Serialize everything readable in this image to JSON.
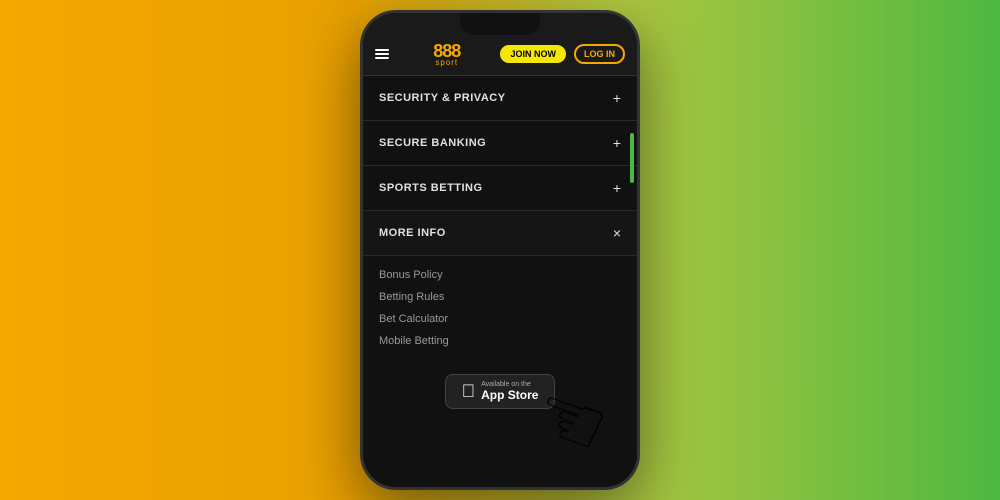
{
  "background": {
    "gradient_from": "#f5a800",
    "gradient_to": "#4db840"
  },
  "header": {
    "logo_888": "888",
    "logo_sport": "sport",
    "join_button": "JOIN NOW",
    "login_button": "LOG IN"
  },
  "accordion": {
    "items": [
      {
        "id": "security",
        "label": "SECURITY & PRIVACY",
        "icon": "+",
        "expanded": false
      },
      {
        "id": "banking",
        "label": "SECURE BANKING",
        "icon": "+",
        "expanded": false
      },
      {
        "id": "sports",
        "label": "SPORTS BETTING",
        "icon": "+",
        "expanded": false
      },
      {
        "id": "more",
        "label": "MORE INFO",
        "icon": "×",
        "expanded": true
      }
    ],
    "more_info_links": [
      "Bonus Policy",
      "Betting Rules",
      "Bet Calculator",
      "Mobile Betting"
    ]
  },
  "app_store": {
    "available_on": "Available on the",
    "name": "App Store"
  }
}
